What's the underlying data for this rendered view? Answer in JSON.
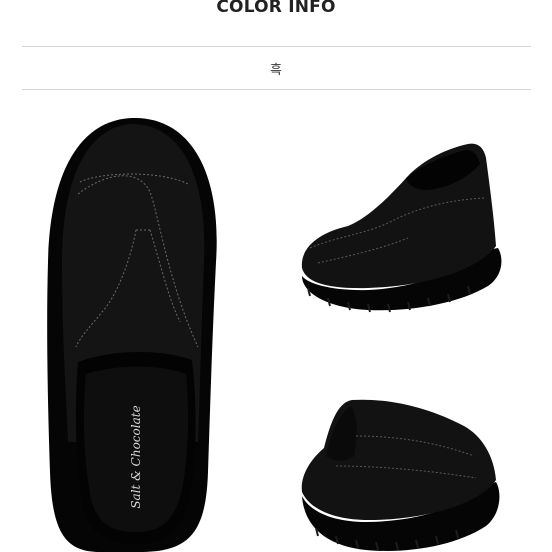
{
  "section": {
    "title": "COLOR INFO",
    "color_name": "흑"
  },
  "product": {
    "brand_insole_text": "Salt & Chocolate",
    "color": "#0b0b0b"
  },
  "images": [
    {
      "name": "shoe-top-view"
    },
    {
      "name": "shoe-side-front-view"
    },
    {
      "name": "shoe-rear-view"
    }
  ]
}
